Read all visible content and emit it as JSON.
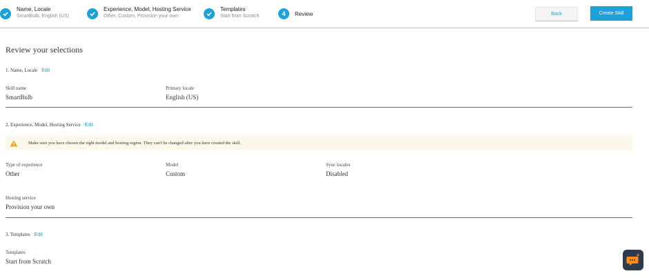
{
  "stepper": {
    "steps": [
      {
        "title": "Name, Locale",
        "subtitle": "SmartBulb, English (US)"
      },
      {
        "title": "Experience, Model, Hosting Service",
        "subtitle": "Other, Custom, Provision your own"
      },
      {
        "title": "Templates",
        "subtitle": "Start from Scratch"
      },
      {
        "number": "4",
        "title": "Review"
      }
    ]
  },
  "actions": {
    "back_label": "Back",
    "create_label": "Create Skill"
  },
  "page_title": "Review your selections",
  "sections": {
    "name_locale": {
      "heading": "1. Name, Locale",
      "edit_label": "Edit",
      "fields": [
        {
          "label": "Skill name",
          "value": "SmartBulb"
        },
        {
          "label": "Primary locale",
          "value": "English (US)"
        }
      ]
    },
    "experience": {
      "heading": "2. Experience, Model, Hosting Service",
      "edit_label": "Edit",
      "warning": "Make sure you have chosen the right model and hosting region. They can't be changed after you have created the skill.",
      "fields": [
        {
          "label": "Type of experience",
          "value": "Other"
        },
        {
          "label": "Model",
          "value": "Custom"
        },
        {
          "label": "Sync locales",
          "value": "Disabled"
        },
        {
          "label": "Hosting service",
          "value": "Provision your own"
        }
      ]
    },
    "templates": {
      "heading": "3. Templates",
      "edit_label": "Edit",
      "fields": [
        {
          "label": "Templates",
          "value": "Start from Scratch"
        }
      ]
    }
  },
  "colors": {
    "accent": "#1da1d8",
    "warning_bg": "#fdf8ec",
    "warning_icon": "#f0a30a",
    "chat_bg": "#2c3b4d",
    "chat_icon": "#ff8c1a"
  },
  "icons": {
    "completed_step": "check-icon",
    "warning": "warning-icon",
    "chat": "chat-icon"
  }
}
